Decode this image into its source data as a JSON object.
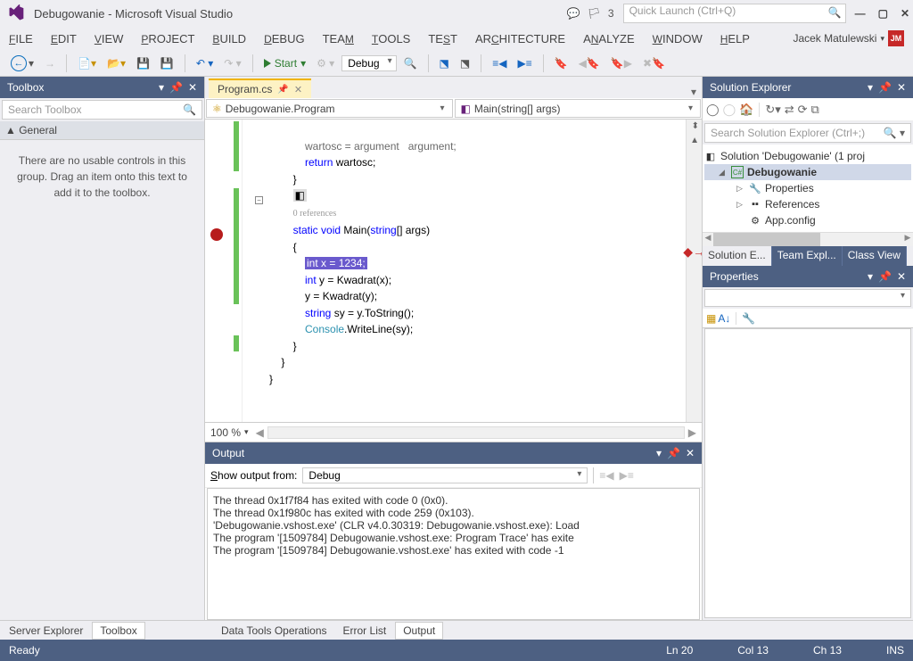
{
  "title": "Debugowanie - Microsoft Visual Studio",
  "notif_count": "3",
  "quick_launch_placeholder": "Quick Launch (Ctrl+Q)",
  "menus": [
    "FILE",
    "EDIT",
    "VIEW",
    "PROJECT",
    "BUILD",
    "DEBUG",
    "TEAM",
    "TOOLS",
    "TEST",
    "ARCHITECTURE",
    "ANALYZE",
    "WINDOW",
    "HELP"
  ],
  "user": "Jacek Matulewski",
  "user_initials": "JM",
  "toolbar": {
    "start": "Start",
    "config": "Debug"
  },
  "toolbox": {
    "title": "Toolbox",
    "search_placeholder": "Search Toolbox",
    "category": "▲ General",
    "empty_msg": "There are no usable controls in this group. Drag an item onto this text to add it to the toolbox."
  },
  "editor": {
    "tab": "Program.cs",
    "class_dd": "Debugowanie.Program",
    "method_dd": "Main(string[] args)",
    "zoom": "100 %",
    "ref_label": "0 references",
    "code_line1_a": "wartosc = argument   argument;",
    "code_line2_kw": "return",
    "code_line2_rest": " wartosc;",
    "code_sig_static": "static",
    "code_sig_void": "void",
    "code_sig_main": " Main(",
    "code_sig_string": "string",
    "code_sig_args": "[] args)",
    "code_hl": "int x = 1234;",
    "code_l2_kw": "int",
    "code_l2_rest": " y = Kwadrat(x);",
    "code_l3": "y = Kwadrat(y);",
    "code_l4_kw": "string",
    "code_l4_rest": " sy = y.ToString();",
    "code_l5_ty": "Console",
    "code_l5_rest": ".WriteLine(sy);"
  },
  "output": {
    "title": "Output",
    "show_from_label": "Show output from:",
    "show_from_value": "Debug",
    "line1": "The thread 0x1f7f84 has exited with code 0 (0x0).",
    "line2": "The thread 0x1f980c has exited with code 259 (0x103).",
    "line3": "'Debugowanie.vshost.exe' (CLR v4.0.30319: Debugowanie.vshost.exe): Load",
    "line4": "The program '[1509784] Debugowanie.vshost.exe: Program Trace' has exite",
    "line5": "The program '[1509784] Debugowanie.vshost.exe' has exited with code -1 "
  },
  "center_bottom_tabs": [
    "Data Tools Operations",
    "Error List",
    "Output"
  ],
  "solution": {
    "title": "Solution Explorer",
    "search_placeholder": "Search Solution Explorer (Ctrl+;)",
    "root": "Solution 'Debugowanie' (1 proj",
    "project": "Debugowanie",
    "items": [
      "Properties",
      "References",
      "App.config"
    ]
  },
  "solution_tabs": [
    "Solution E...",
    "Team Expl...",
    "Class View"
  ],
  "properties": {
    "title": "Properties"
  },
  "left_bottom_tabs": [
    "Server Explorer",
    "Toolbox"
  ],
  "status": {
    "ready": "Ready",
    "ln": "Ln 20",
    "col": "Col 13",
    "ch": "Ch 13",
    "ins": "INS"
  }
}
